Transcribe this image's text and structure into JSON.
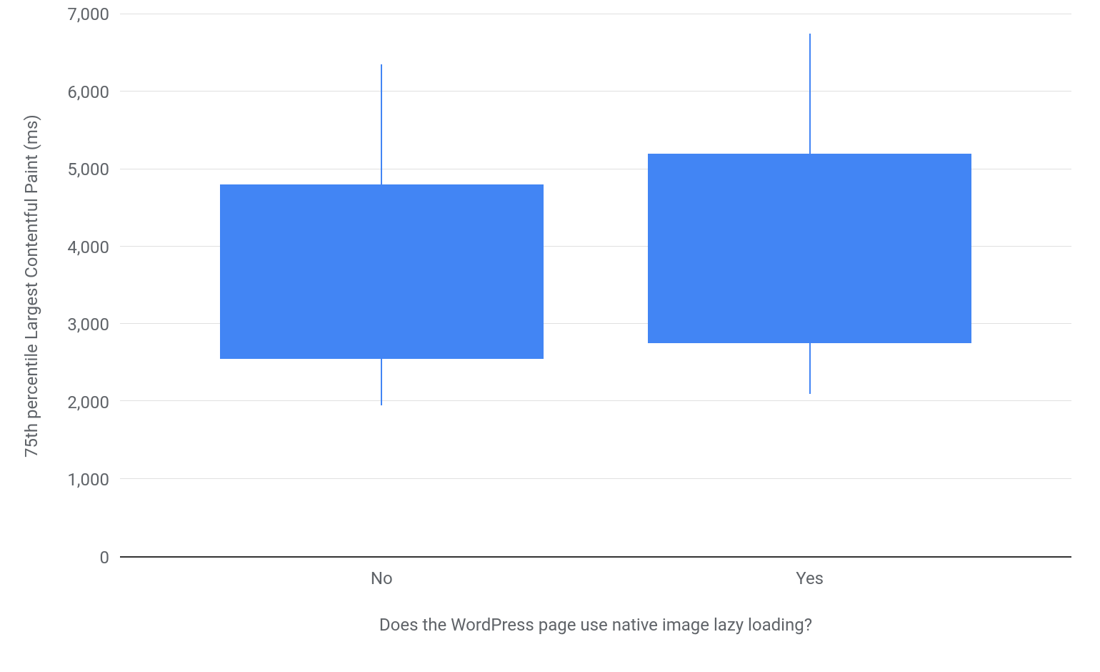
{
  "chart_data": {
    "type": "box",
    "title": "",
    "xlabel": "Does the WordPress page use native image lazy loading?",
    "ylabel": "75th percentile Largest Contentful Paint (ms)",
    "ylim": [
      0,
      7000
    ],
    "ytick_step": 1000,
    "yticks": [
      "0",
      "1,000",
      "2,000",
      "3,000",
      "4,000",
      "5,000",
      "6,000",
      "7,000"
    ],
    "categories": [
      "No",
      "Yes"
    ],
    "series": [
      {
        "name": "No",
        "whisker_low": 1950,
        "q1": 2550,
        "q3": 4800,
        "whisker_high": 6350
      },
      {
        "name": "Yes",
        "whisker_low": 2100,
        "q1": 2750,
        "q3": 5200,
        "whisker_high": 6750
      }
    ],
    "box_color": "#4285f4",
    "grid": true
  }
}
